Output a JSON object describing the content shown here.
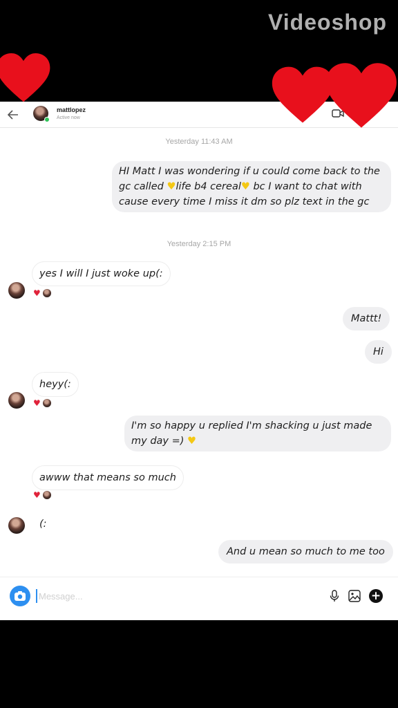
{
  "watermark": "Videoshop",
  "header": {
    "username": "mattlopez",
    "status": "Active now"
  },
  "timestamps": [
    "Yesterday 11:43 AM",
    "Yesterday 2:15 PM"
  ],
  "messages": [
    {
      "text_a": "HI Matt I was wondering if u could come back to the gc called ",
      "emoji1": "♥",
      "text_b": "life b4 cereal",
      "emoji2": "♥",
      "text_c": " bc I want to chat with cause every time I miss it dm so plz text in the gc"
    },
    {
      "text": "yes I will I just woke up(:"
    },
    {
      "text": "Mattt!"
    },
    {
      "text": "Hi"
    },
    {
      "text": "heyy(:"
    },
    {
      "text_a": "I'm so happy u replied I'm shacking u just made my day =) ",
      "emoji": "♥"
    },
    {
      "text": "awww that means so much"
    },
    {
      "text": "(:"
    },
    {
      "text": "And u mean so much to me too"
    }
  ],
  "reaction": {
    "heart": "♥"
  },
  "composer": {
    "placeholder": "Message..."
  },
  "colors": {
    "accent": "#2d8ff0",
    "heart_red": "#e0223a",
    "emoji_yellow": "#f4c814"
  },
  "icons": [
    "back-arrow-icon",
    "video-call-icon",
    "camera-icon",
    "microphone-icon",
    "gallery-icon",
    "plus-icon",
    "heart-icon"
  ]
}
